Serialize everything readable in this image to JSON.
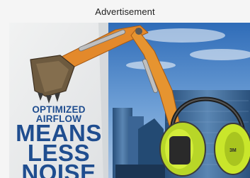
{
  "ad_label": "Advertisement",
  "banner": {
    "headline_lines": [
      "OPTIMIZED",
      "AIRFLOW",
      "MEANS",
      "LESS",
      "NOISE"
    ],
    "earmuff_mark": "3M"
  },
  "colors": {
    "headline_blue": "#1f4d8f",
    "sky_blue": "#3f7fc6",
    "excavator_orange": "#e3892b",
    "earmuff_green": "#c9e62b"
  }
}
